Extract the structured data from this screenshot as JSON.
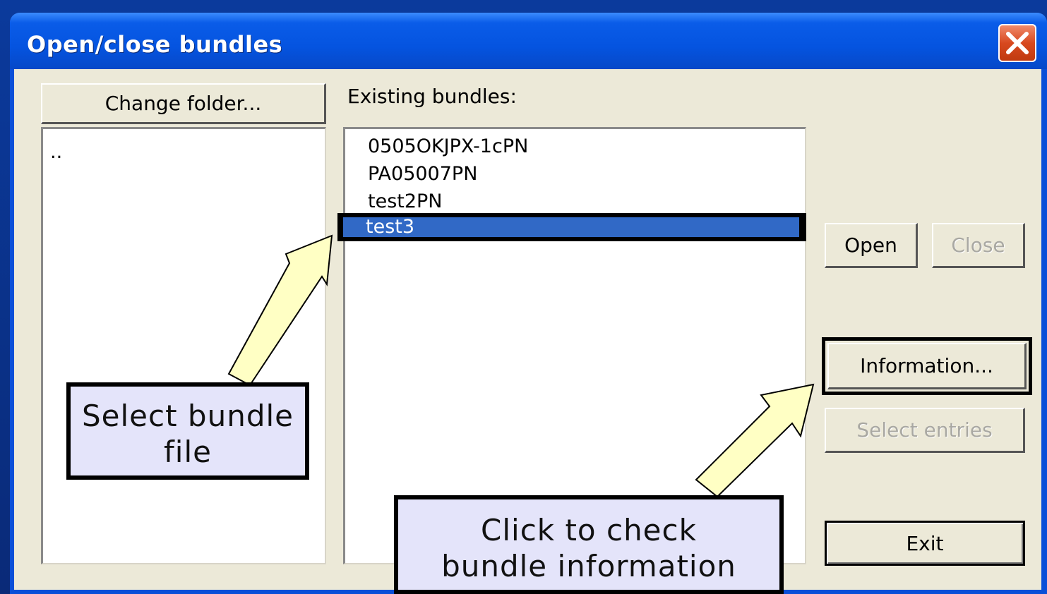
{
  "window": {
    "title": "Open/close bundles",
    "close_icon": "close-x-icon"
  },
  "left_panel": {
    "change_folder_label": "Change folder...",
    "folder_items": [
      ".."
    ]
  },
  "bundles": {
    "header": "Existing bundles:",
    "items": [
      "0505OKJPX-1cPN",
      "PA05007PN",
      "test2PN"
    ],
    "selected": "test3"
  },
  "buttons": {
    "open": "Open",
    "close": "Close",
    "information": "Information...",
    "select_entries": "Select entries",
    "exit": "Exit"
  },
  "callouts": {
    "select_bundle": "Select bundle file",
    "check_info": "Click to check bundle information"
  },
  "colors": {
    "title_bar": "#0554e0",
    "dialog_bg": "#ece9d8",
    "selection": "#3169c6",
    "callout_bg": "#e4e4fa",
    "arrow_fill": "#ffffc4"
  }
}
